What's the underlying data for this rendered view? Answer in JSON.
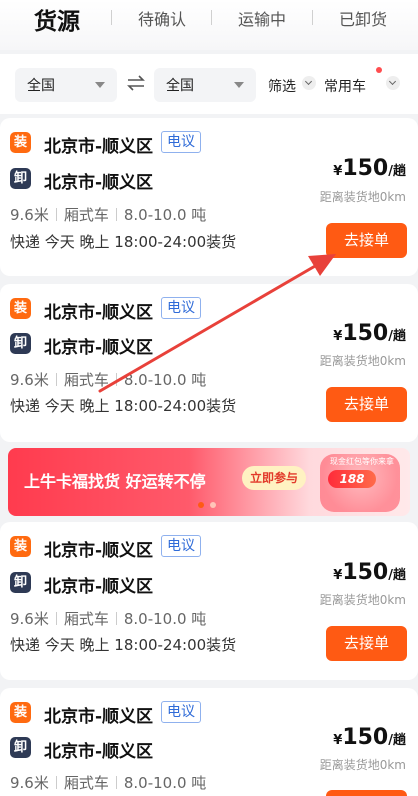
{
  "tabs": [
    {
      "label": "货源",
      "active": true
    },
    {
      "label": "待确认",
      "active": false
    },
    {
      "label": "运输中",
      "active": false
    },
    {
      "label": "已卸货",
      "active": false
    }
  ],
  "filters": {
    "from": "全国",
    "to": "全国",
    "filter_label": "筛选",
    "common_vehicle_label": "常用车"
  },
  "cards": [
    {
      "load_badge": "装",
      "unload_badge": "卸",
      "load_city": "北京市-顺义区",
      "unload_city": "北京市-顺义区",
      "tag": "电议",
      "length": "9.6米",
      "vehicle": "厢式车",
      "weight": "8.0-10.0 吨",
      "time": "快递 今天 晚上 18:00-24:00装货",
      "price_symbol": "¥",
      "price": "150",
      "price_unit": "/趟",
      "distance": "距离装货地0km",
      "button": "去接单"
    },
    {
      "load_badge": "装",
      "unload_badge": "卸",
      "load_city": "北京市-顺义区",
      "unload_city": "北京市-顺义区",
      "tag": "电议",
      "length": "9.6米",
      "vehicle": "厢式车",
      "weight": "8.0-10.0 吨",
      "time": "快递 今天 晚上 18:00-24:00装货",
      "price_symbol": "¥",
      "price": "150",
      "price_unit": "/趟",
      "distance": "距离装货地0km",
      "button": "去接单"
    },
    {
      "load_badge": "装",
      "unload_badge": "卸",
      "load_city": "北京市-顺义区",
      "unload_city": "北京市-顺义区",
      "tag": "电议",
      "length": "9.6米",
      "vehicle": "厢式车",
      "weight": "8.0-10.0 吨",
      "time": "快递 今天 晚上 18:00-24:00装货",
      "price_symbol": "¥",
      "price": "150",
      "price_unit": "/趟",
      "distance": "距离装货地0km",
      "button": "去接单"
    },
    {
      "load_badge": "装",
      "unload_badge": "卸",
      "load_city": "北京市-顺义区",
      "unload_city": "北京市-顺义区",
      "tag": "电议",
      "length": "9.6米",
      "vehicle": "厢式车",
      "weight": "8.0-10.0 吨",
      "price_symbol": "¥",
      "price": "150",
      "price_unit": "/趟",
      "distance": "距离装货地0km"
    }
  ],
  "banner": {
    "title": "上牛卡福找货 好运转不停",
    "button": "立即参与",
    "amount": "188",
    "caption": "现金红包等你来拿",
    "dots_active_index": 0
  },
  "colors": {
    "accent": "#ff5a13",
    "load_badge": "#ff6a10",
    "unload_badge": "#2e3a55",
    "tag": "#2f6bd8",
    "annotation_arrow": "#e8413a"
  },
  "icons": {
    "swap": "swap-arrows-icon",
    "dropdown": "caret-down-icon",
    "chevron": "chevron-down-icon"
  }
}
